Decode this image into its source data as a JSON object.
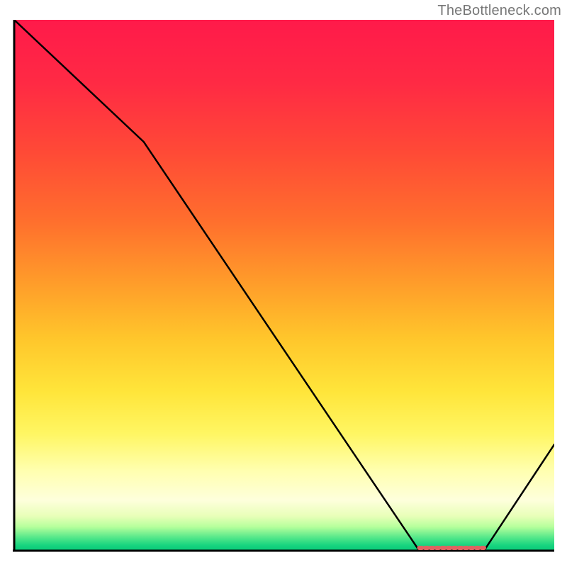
{
  "watermark": "TheBottleneck.com",
  "chart_data": {
    "type": "line",
    "title": "",
    "xlabel": "",
    "ylabel": "",
    "xlim": [
      0,
      100
    ],
    "ylim": [
      0,
      100
    ],
    "grid": false,
    "series": [
      {
        "name": "curve",
        "color": "#000000",
        "x": [
          0,
          24,
          75,
          87,
          100
        ],
        "y": [
          100,
          77,
          0,
          0,
          20
        ]
      }
    ],
    "gradient_stops": [
      {
        "offset": 0.0,
        "color": "#ff1a4a"
      },
      {
        "offset": 0.12,
        "color": "#ff2a44"
      },
      {
        "offset": 0.25,
        "color": "#ff4a36"
      },
      {
        "offset": 0.38,
        "color": "#ff6f2d"
      },
      {
        "offset": 0.5,
        "color": "#ff9e2a"
      },
      {
        "offset": 0.6,
        "color": "#ffc62b"
      },
      {
        "offset": 0.7,
        "color": "#ffe53a"
      },
      {
        "offset": 0.78,
        "color": "#fff663"
      },
      {
        "offset": 0.85,
        "color": "#ffffb0"
      },
      {
        "offset": 0.905,
        "color": "#feffdc"
      },
      {
        "offset": 0.935,
        "color": "#e8ffb8"
      },
      {
        "offset": 0.955,
        "color": "#b6ff9c"
      },
      {
        "offset": 0.975,
        "color": "#55e88a"
      },
      {
        "offset": 0.99,
        "color": "#17d47f"
      },
      {
        "offset": 1.0,
        "color": "#08c878"
      }
    ],
    "marker": {
      "color": "#e16261",
      "x_start": 75,
      "x_end": 87,
      "y": 0
    }
  }
}
